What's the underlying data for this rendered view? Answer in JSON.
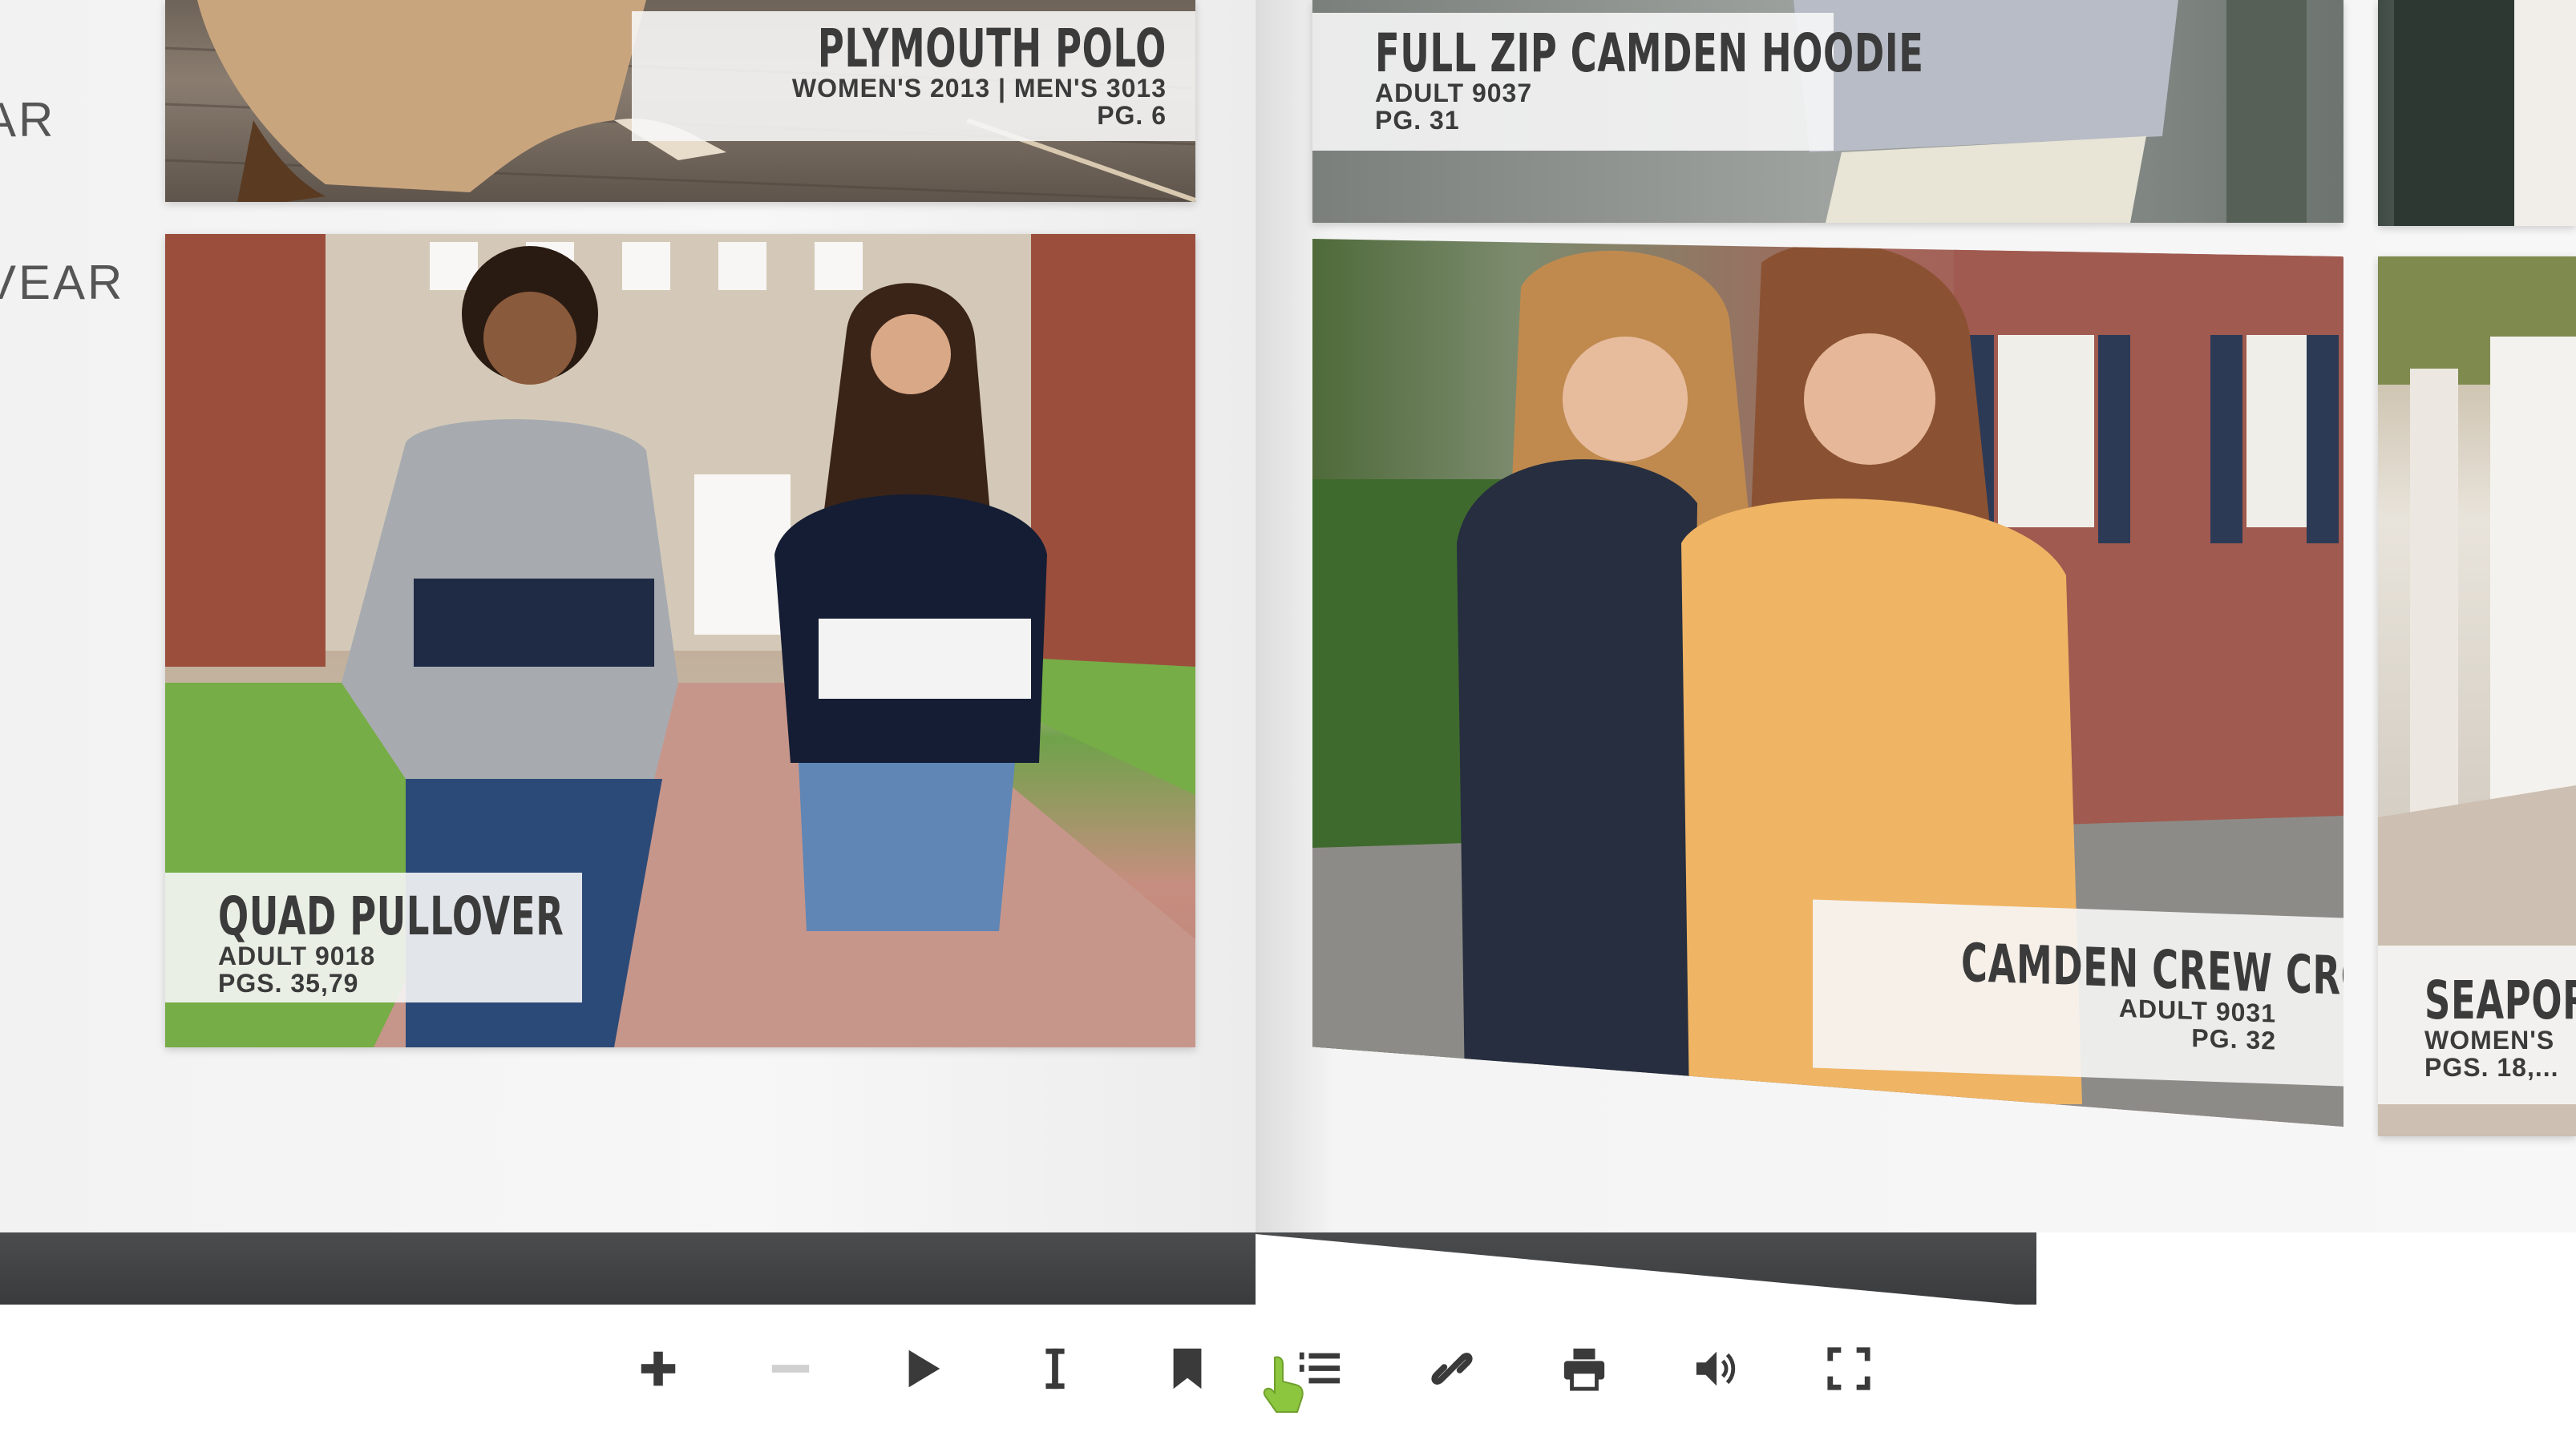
{
  "pages": {
    "left_headings": [
      "AR",
      "VEAR"
    ]
  },
  "products": [
    {
      "title": "PLYMOUTH POLO",
      "line1": "WOMEN'S 2013 | MEN'S 3013",
      "line2": "PG. 6"
    },
    {
      "title": "QUAD PULLOVER",
      "line1": "ADULT 9018",
      "line2": "PGS. 35,79"
    },
    {
      "title": "FULL ZIP CAMDEN HOODIE",
      "line1": "ADULT 9037",
      "line2": "PG. 31"
    },
    {
      "title": "CAMDEN CREW CROP",
      "line1": "ADULT 9031",
      "line2": "PG. 32"
    },
    {
      "title": "SEAPORT",
      "line1": "WOMEN'S",
      "line2": "PGS. 18,..."
    }
  ],
  "toolbar": {
    "buttons": [
      {
        "icon": "zoom-in-icon",
        "enabled": true
      },
      {
        "icon": "zoom-out-icon",
        "enabled": false
      },
      {
        "icon": "play-icon",
        "enabled": true
      },
      {
        "icon": "text-cursor-icon",
        "enabled": true
      },
      {
        "icon": "bookmark-icon",
        "enabled": true
      },
      {
        "icon": "table-of-contents-icon",
        "enabled": true
      },
      {
        "icon": "link-icon",
        "enabled": true
      },
      {
        "icon": "print-icon",
        "enabled": true
      },
      {
        "icon": "sound-icon",
        "enabled": true
      },
      {
        "icon": "fullscreen-icon",
        "enabled": true
      }
    ],
    "icon_color": "#3a3a3a",
    "disabled_color": "#d0d0d0",
    "cursor": "hand-pointer-icon",
    "cursor_color": "#8cc63f"
  },
  "colors": {
    "caption_text": "#3b3b3b",
    "spine_shadow": "#3a3b3d"
  }
}
